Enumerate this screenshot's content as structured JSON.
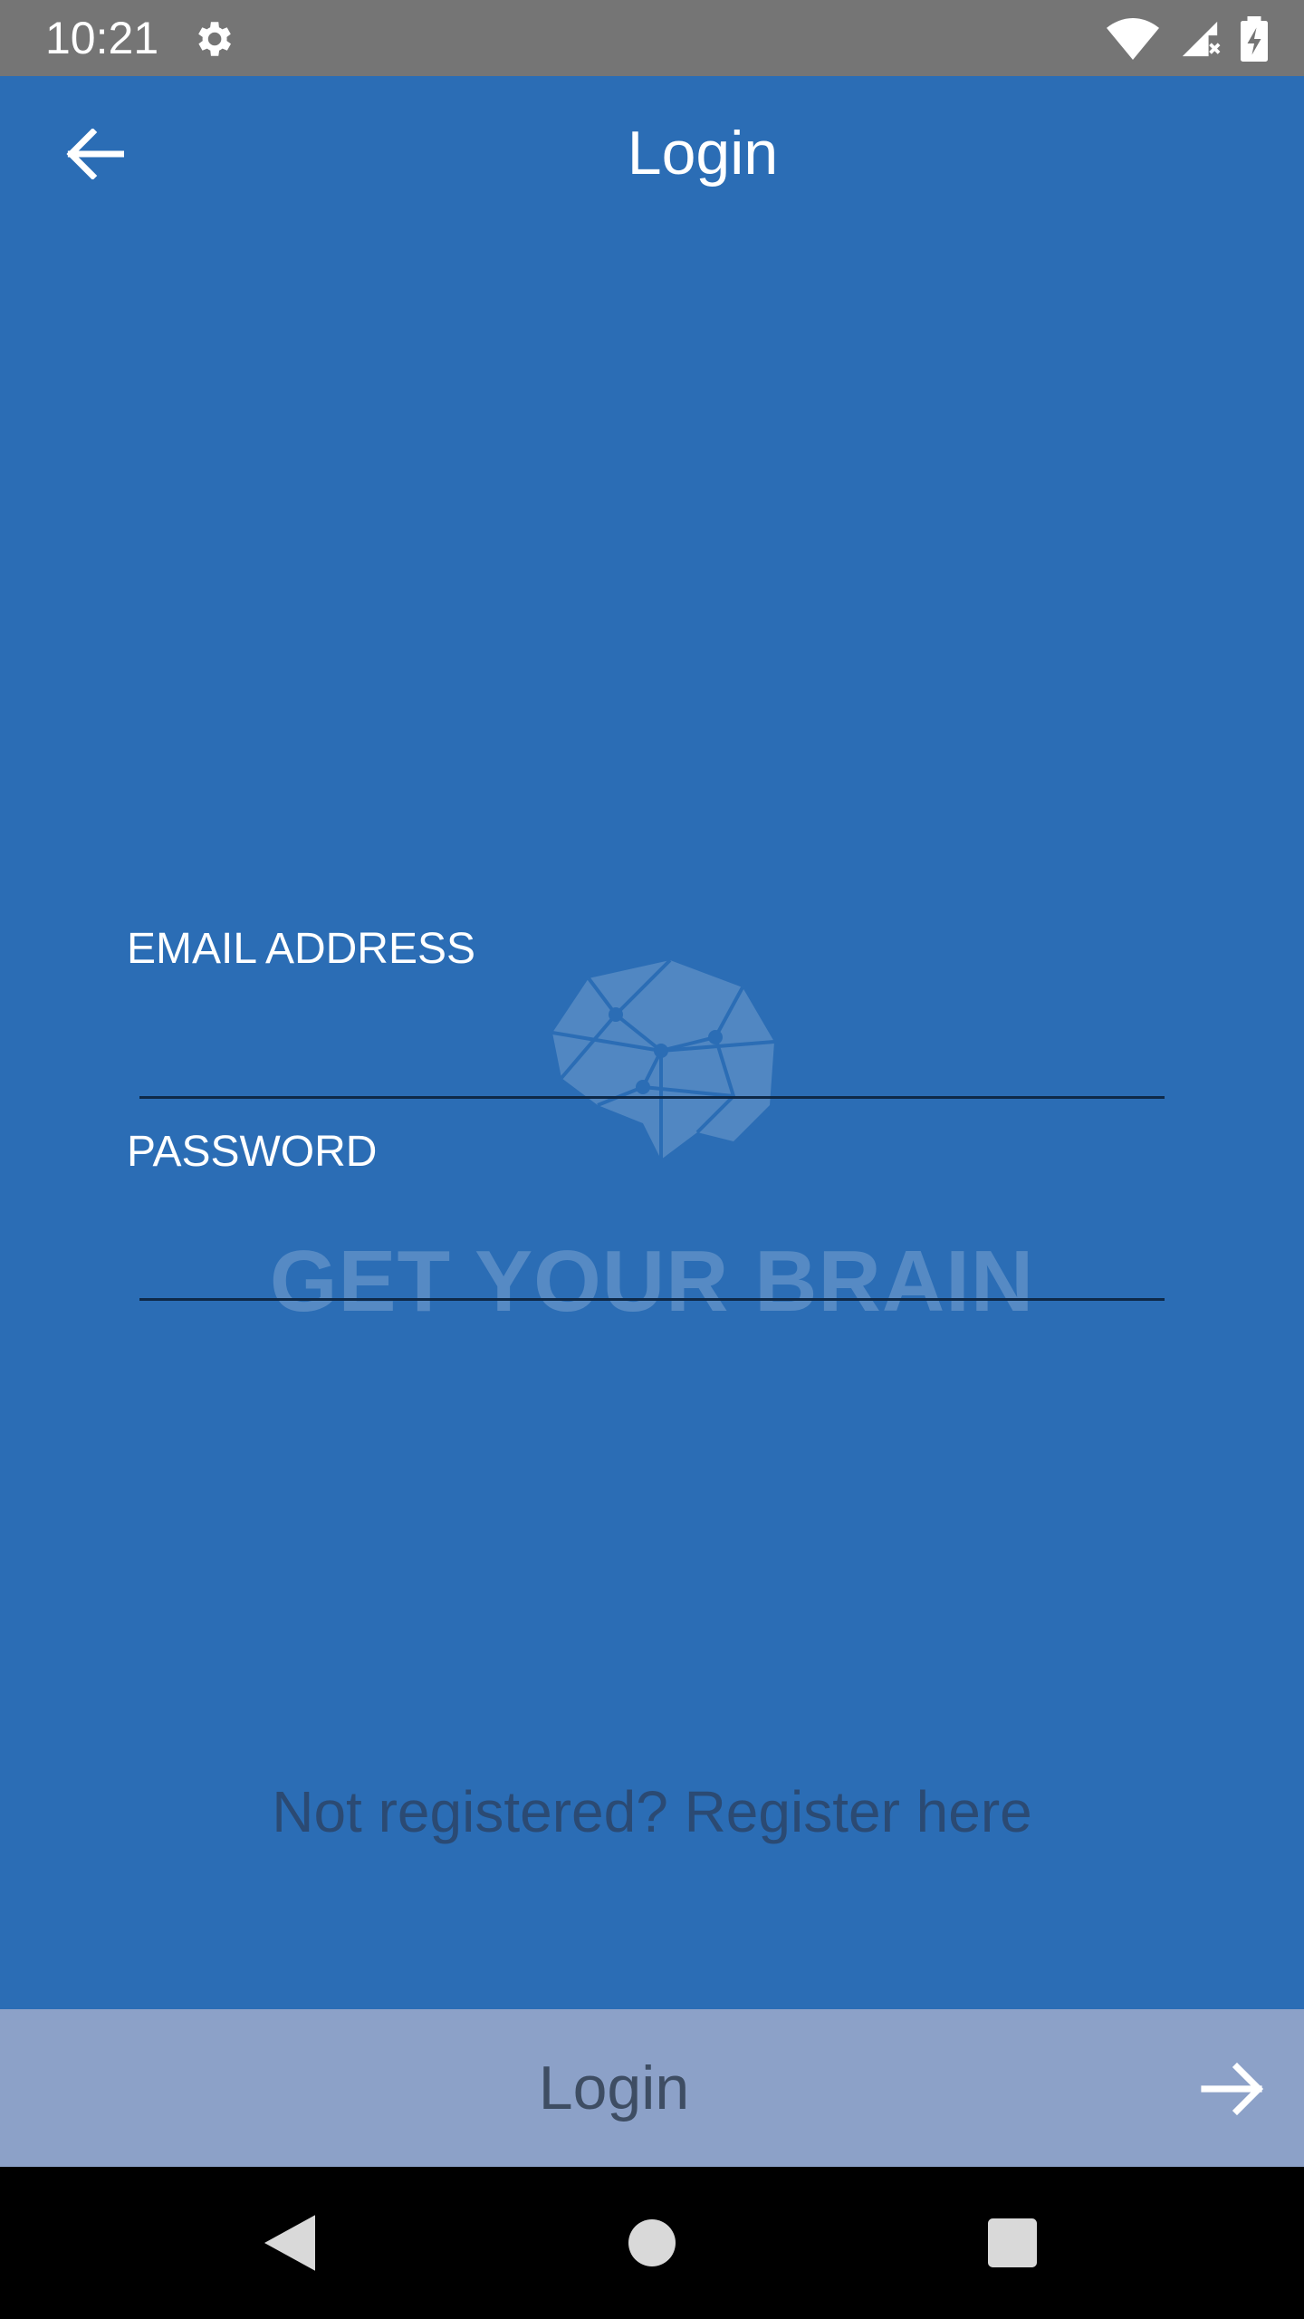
{
  "status_bar": {
    "time": "10:21",
    "icons": [
      "gear-icon",
      "wifi-icon",
      "signal-icon",
      "battery-charging-icon"
    ]
  },
  "app_bar": {
    "title": "Login",
    "back_icon": "arrow-left-icon"
  },
  "watermark": {
    "logo_icon": "brain-logo-icon",
    "brand_text": "GET YOUR BRAIN"
  },
  "form": {
    "email": {
      "label": "EMAIL ADDRESS",
      "value": "",
      "placeholder": ""
    },
    "password": {
      "label": "PASSWORD",
      "value": "",
      "placeholder": ""
    }
  },
  "register": {
    "link_text": "Not registered? Register here"
  },
  "login_button": {
    "label": "Login",
    "icon": "arrow-right-icon"
  },
  "nav_bar": {
    "icons": [
      "nav-back-icon",
      "nav-home-icon",
      "nav-recents-icon"
    ]
  },
  "colors": {
    "background": "#2b6db5",
    "status_bar": "#757575",
    "login_bar": "#8ca1c8",
    "login_text": "#3e4d63",
    "register_text": "#2b4a73",
    "underline": "#0e2948",
    "nav_bar": "#000000"
  }
}
